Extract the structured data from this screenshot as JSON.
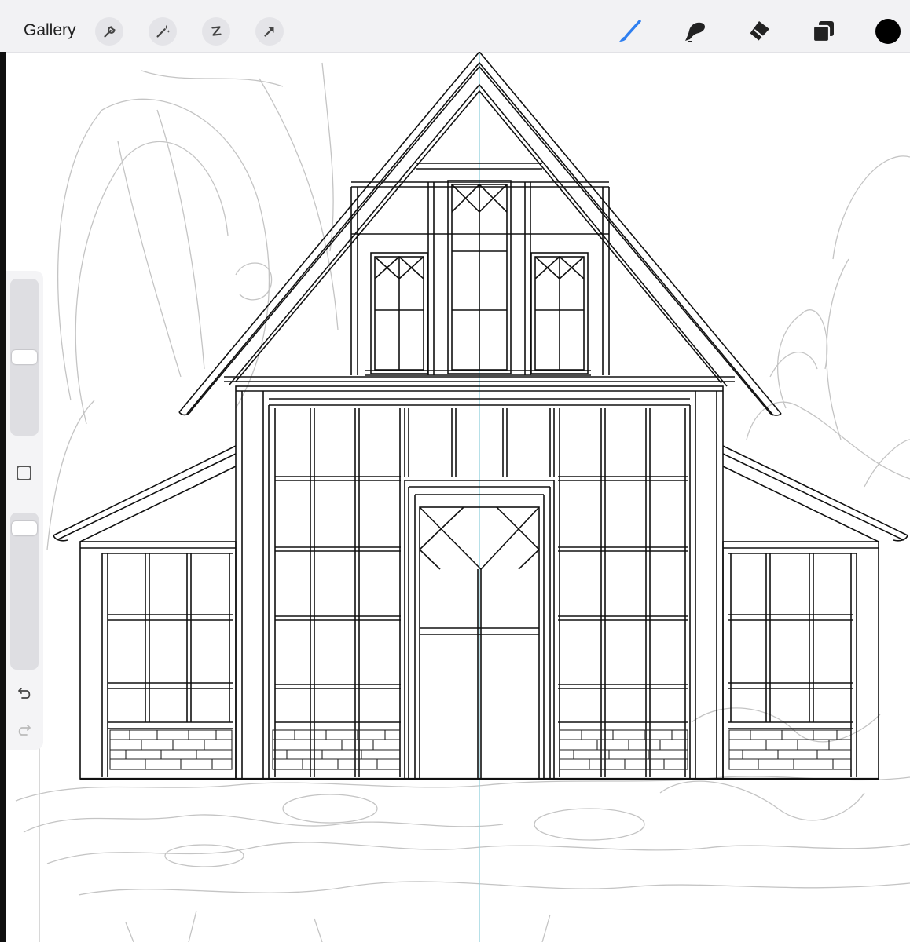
{
  "toolbar": {
    "gallery_label": "Gallery",
    "left_tools": [
      "wrench-icon",
      "magic-wand-icon",
      "selection-icon",
      "transform-arrow-icon"
    ],
    "right_tools": [
      "brush-icon",
      "smudge-icon",
      "eraser-icon",
      "layers-icon"
    ],
    "active_tool": "brush-icon",
    "accent_color": "#2f7ff0",
    "current_color": "#000000"
  },
  "sidebar": {
    "icons": [
      "modify-square-icon",
      "undo-icon",
      "redo-icon"
    ],
    "brush_size_level": 0.5,
    "opacity_level": 0.02
  },
  "canvas": {
    "subject": "house-line-drawing",
    "guide_color": "#8fd0dc"
  }
}
